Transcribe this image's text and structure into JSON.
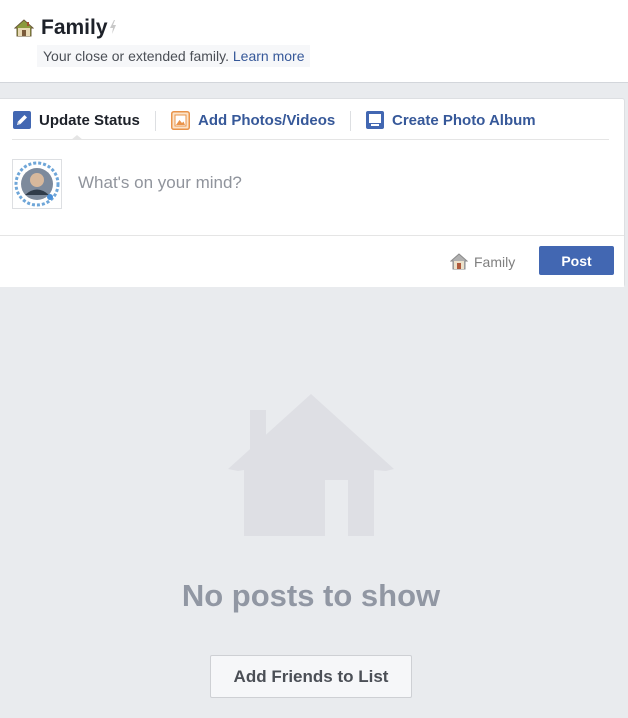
{
  "header": {
    "title": "Family",
    "description": "Your close or extended family.",
    "learn_more": "Learn more",
    "icon": "home-icon",
    "badge_icon": "bolt-icon"
  },
  "composer": {
    "tabs": [
      {
        "label": "Update Status",
        "icon": "pencil-icon",
        "active": true
      },
      {
        "label": "Add Photos/Videos",
        "icon": "photo-icon",
        "active": false
      },
      {
        "label": "Create Photo Album",
        "icon": "album-icon",
        "active": false
      }
    ],
    "placeholder": "What's on your mind?",
    "audience_label": "Family",
    "audience_icon": "home-icon",
    "post_label": "Post"
  },
  "empty_state": {
    "icon": "house-icon",
    "message": "No posts to show",
    "button_label": "Add Friends to List"
  },
  "colors": {
    "brand": "#4267b2",
    "link": "#365899",
    "background": "#e9ebee",
    "empty_text": "#9197a3"
  }
}
